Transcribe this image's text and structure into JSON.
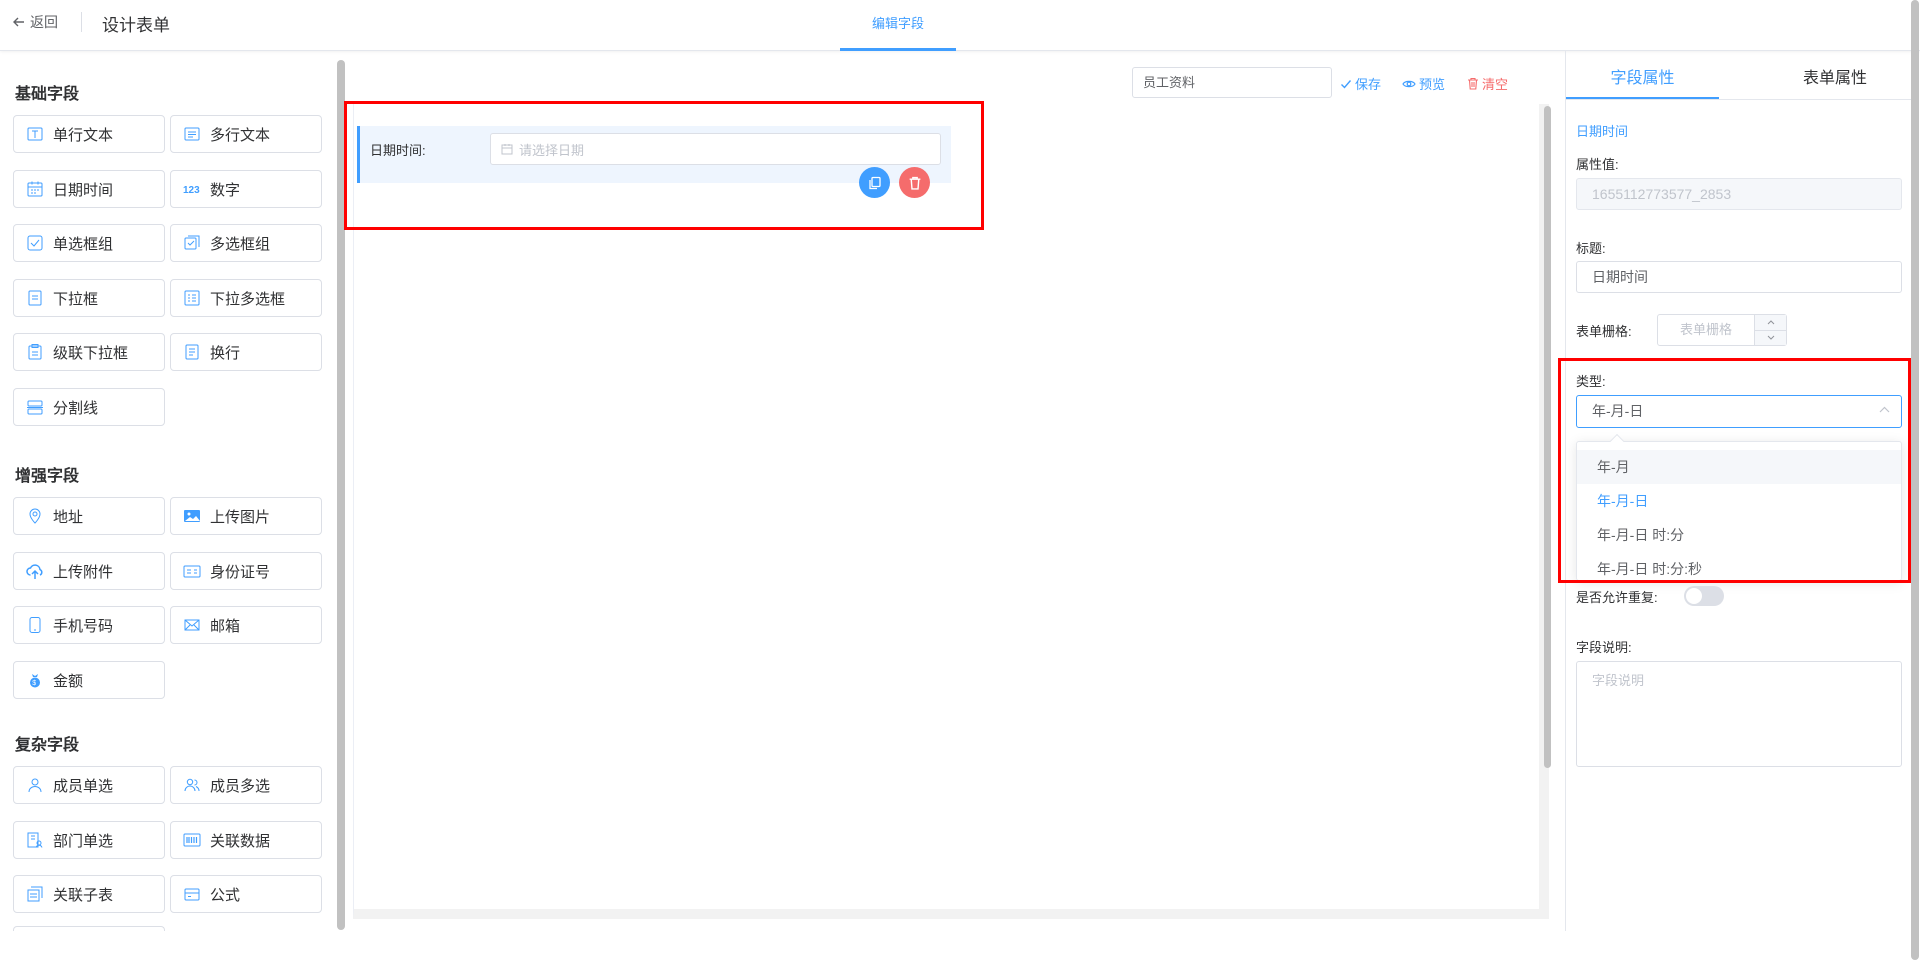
{
  "header": {
    "back_label": "返回",
    "title": "设计表单",
    "center_tab": "编辑字段"
  },
  "left_panel": {
    "sections": [
      {
        "title": "基础字段",
        "items": [
          {
            "label": "单行文本",
            "icon": "single-line-text-icon"
          },
          {
            "label": "多行文本",
            "icon": "multi-line-text-icon"
          },
          {
            "label": "日期时间",
            "icon": "calendar-icon"
          },
          {
            "label": "数字",
            "icon": "number-icon"
          },
          {
            "label": "单选框组",
            "icon": "radio-group-icon"
          },
          {
            "label": "多选框组",
            "icon": "checkbox-group-icon"
          },
          {
            "label": "下拉框",
            "icon": "dropdown-icon"
          },
          {
            "label": "下拉多选框",
            "icon": "multi-dropdown-icon"
          },
          {
            "label": "级联下拉框",
            "icon": "cascader-icon"
          },
          {
            "label": "换行",
            "icon": "line-break-icon"
          },
          {
            "label": "分割线",
            "icon": "divider-icon"
          }
        ]
      },
      {
        "title": "增强字段",
        "items": [
          {
            "label": "地址",
            "icon": "location-icon"
          },
          {
            "label": "上传图片",
            "icon": "image-icon"
          },
          {
            "label": "上传附件",
            "icon": "upload-cloud-icon"
          },
          {
            "label": "身份证号",
            "icon": "id-card-icon"
          },
          {
            "label": "手机号码",
            "icon": "phone-icon"
          },
          {
            "label": "邮箱",
            "icon": "mail-icon"
          },
          {
            "label": "金额",
            "icon": "money-bag-icon"
          }
        ]
      },
      {
        "title": "复杂字段",
        "items": [
          {
            "label": "成员单选",
            "icon": "user-icon"
          },
          {
            "label": "成员多选",
            "icon": "users-icon"
          },
          {
            "label": "部门单选",
            "icon": "department-icon"
          },
          {
            "label": "关联数据",
            "icon": "barcode-icon"
          },
          {
            "label": "关联子表",
            "icon": "sub-table-icon"
          },
          {
            "label": "公式",
            "icon": "formula-icon"
          }
        ]
      }
    ]
  },
  "toolbar": {
    "form_name": "员工资料",
    "save_label": "保存",
    "preview_label": "预览",
    "clear_label": "清空"
  },
  "canvas": {
    "field": {
      "label": "日期时间:",
      "placeholder": "请选择日期"
    }
  },
  "properties": {
    "tab_field": "字段属性",
    "tab_form": "表单属性",
    "field_type_name": "日期时间",
    "attr_value_label": "属性值:",
    "attr_value": "1655112773577_2853",
    "title_label": "标题:",
    "title_value": "日期时间",
    "grid_label": "表单栅格:",
    "grid_placeholder": "表单栅格",
    "type_label": "类型:",
    "type_value": "年-月-日",
    "type_options": [
      "年-月",
      "年-月-日",
      "年-月-日 时:分",
      "年-月-日 时:分:秒"
    ],
    "type_selected_index": 1,
    "allow_repeat_label": "是否允许重复:",
    "allow_repeat": false,
    "desc_label": "字段说明:",
    "desc_placeholder": "字段说明"
  },
  "colors": {
    "accent": "#409eff",
    "danger": "#f56c6c",
    "highlight_box": "#ff0000"
  }
}
